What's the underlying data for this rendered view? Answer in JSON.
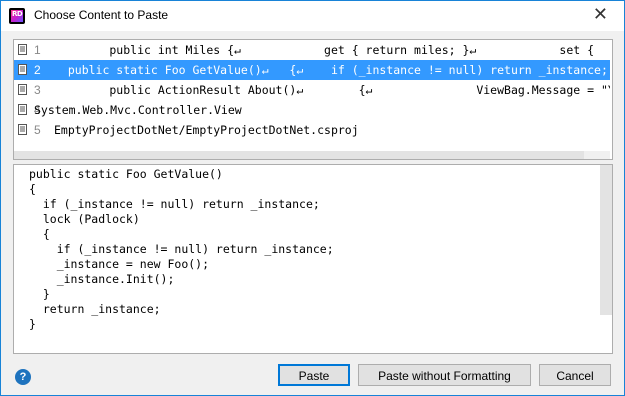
{
  "window": {
    "title": "Choose Content to Paste",
    "app_icon_text": "RD",
    "close_glyph": "✕"
  },
  "list": {
    "items": [
      {
        "num": "1",
        "text": "        public int Miles {↵            get { return miles; }↵            set { ",
        "selected": false
      },
      {
        "num": "2",
        "text": "  public static Foo GetValue()↵   {↵    if (_instance != null) return _instance;",
        "selected": true
      },
      {
        "num": "3",
        "text": "        public ActionResult About()↵        {↵               ViewBag.Message = \"Yo",
        "selected": false
      },
      {
        "num": "4",
        "text": "System.Web.Mvc.Controller.View",
        "selected": false
      },
      {
        "num": "5",
        "text": "EmptyProjectDotNet/EmptyProjectDotNet.csproj",
        "selected": false
      }
    ]
  },
  "preview": {
    "text": "public static Foo GetValue()\n{\n  if (_instance != null) return _instance;\n  lock (Padlock)\n  {\n    if (_instance != null) return _instance;\n    _instance = new Foo();\n    _instance.Init();\n  }\n  return _instance;\n}"
  },
  "buttons": {
    "help": "?",
    "paste": "Paste",
    "paste_without_formatting": "Paste without Formatting",
    "cancel": "Cancel"
  }
}
